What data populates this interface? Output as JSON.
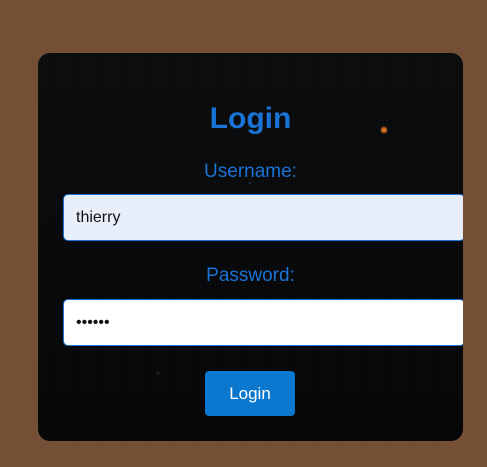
{
  "colors": {
    "page_background": "#744f36",
    "accent": "#1a73d6",
    "input_border": "#1a73d6",
    "username_fill": "#e8effb",
    "password_fill": "#ffffff",
    "button_background": "#0b78d0",
    "button_text": "#ffffff"
  },
  "login": {
    "title": "Login",
    "username_label": "Username:",
    "username_value": "thierry",
    "password_label": "Password:",
    "password_value": "thierr",
    "submit_label": "Login"
  }
}
